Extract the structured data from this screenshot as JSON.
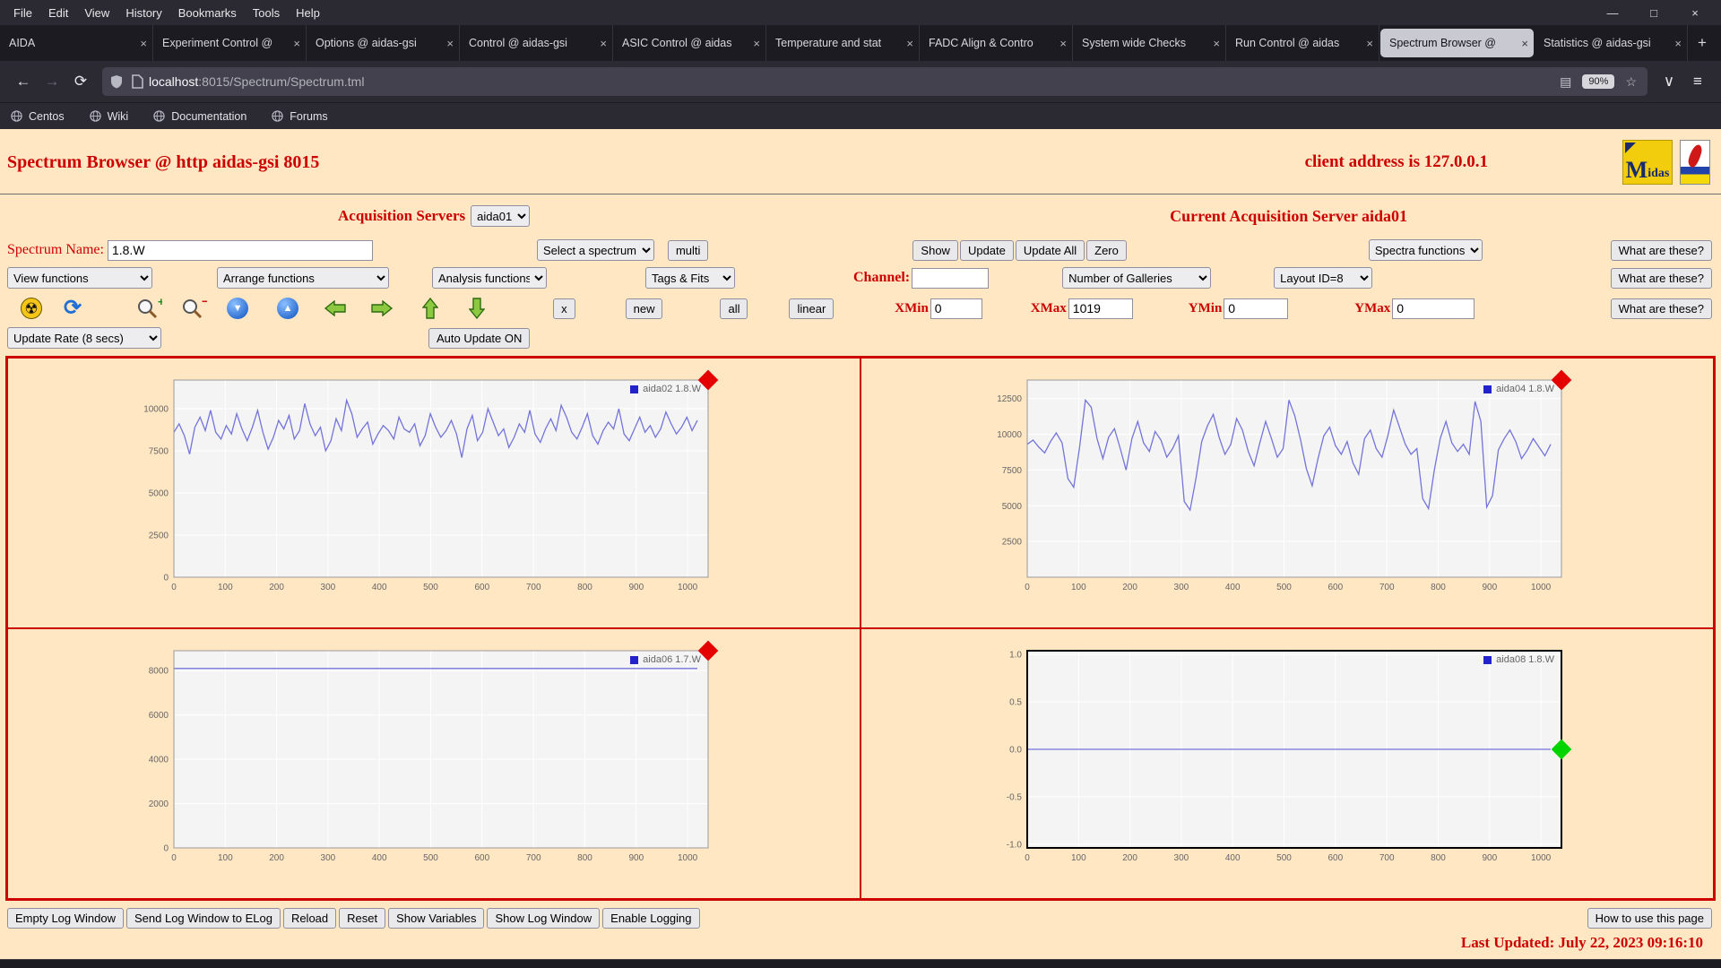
{
  "browser": {
    "menubar": {
      "items": [
        "File",
        "Edit",
        "View",
        "History",
        "Bookmarks",
        "Tools",
        "Help"
      ]
    },
    "window_controls": {
      "minimize": "—",
      "maximize": "□",
      "close": "×"
    },
    "tab_close_glyph": "×",
    "new_tab_button": "+",
    "tabs": [
      {
        "label": "AIDA",
        "active": false
      },
      {
        "label": "Experiment Control @",
        "active": false
      },
      {
        "label": "Options @ aidas-gsi",
        "active": false
      },
      {
        "label": "Control @ aidas-gsi",
        "active": false
      },
      {
        "label": "ASIC Control @ aidas",
        "active": false
      },
      {
        "label": "Temperature and stat",
        "active": false
      },
      {
        "label": "FADC Align & Contro",
        "active": false
      },
      {
        "label": "System wide Checks",
        "active": false
      },
      {
        "label": "Run Control @ aidas",
        "active": false
      },
      {
        "label": "Spectrum Browser @",
        "active": true
      },
      {
        "label": "Statistics @ aidas-gsi",
        "active": false
      }
    ],
    "navbar": {
      "back_glyph": "←",
      "forward_glyph": "→",
      "reload_glyph": "⟳",
      "reader_glyph": "▤",
      "star_glyph": "☆",
      "pocket_glyph": "∨",
      "menu_glyph": "≡",
      "url_host": "localhost",
      "url_rest": ":8015/Spectrum/Spectrum.tml",
      "zoom_badge": "90%"
    },
    "bookmarks": [
      "Centos",
      "Wiki",
      "Documentation",
      "Forums"
    ]
  },
  "page": {
    "title": "Spectrum Browser @ http aidas-gsi 8015",
    "client_address": "client address is 127.0.0.1",
    "midas_logo_text_m": "M",
    "midas_logo_text_rest": "idas",
    "acquisition": {
      "label": "Acquisition Servers",
      "selected": "aida01",
      "current": "Current Acquisition Server aida01"
    },
    "what_are_these": "What are these?",
    "spectrum_row": {
      "name_label": "Spectrum Name:",
      "name_value": "1.8.W",
      "select_spectrum": "Select a spectrum",
      "multi": "multi",
      "show": "Show",
      "update": "Update",
      "update_all": "Update All",
      "zero": "Zero",
      "spectra_functions": "Spectra functions"
    },
    "functions_row": {
      "view": "View functions",
      "arrange": "Arrange functions",
      "analysis": "Analysis functions",
      "tags": "Tags & Fits",
      "channel_label": "Channel:",
      "channel_value": "",
      "galleries": "Number of Galleries",
      "layout": "Layout ID=8"
    },
    "toolbar_row": {
      "icon_names": [
        "radiation-icon",
        "refresh-icon",
        "zoom-in-icon",
        "zoom-out-icon",
        "compress-y-icon",
        "expand-y-icon",
        "move-left-icon",
        "move-right-icon",
        "move-up-icon",
        "move-down-icon"
      ],
      "x": "x",
      "new": "new",
      "all": "all",
      "linear": "linear",
      "xmin_label": "XMin",
      "xmin_value": "0",
      "xmax_label": "XMax",
      "xmax_value": "1019",
      "ymin_label": "YMin",
      "ymin_value": "0",
      "ymax_label": "YMax",
      "ymax_value": "0"
    },
    "update_row": {
      "rate": "Update Rate (8 secs)",
      "auto": "Auto Update ON"
    },
    "log_row": {
      "buttons": [
        "Empty Log Window",
        "Send Log Window to ELog",
        "Reload",
        "Reset",
        "Show Variables",
        "Show Log Window",
        "Enable Logging"
      ],
      "help": "How to use this page"
    },
    "last_updated": "Last Updated: July 22, 2023 09:16:10"
  },
  "chart_data": {
    "type": "line",
    "plot_bg": "#f4f4f4",
    "grid_color": "#ffffff",
    "line_color": "#7474da",
    "x_axis": {
      "tick_values": [
        0,
        100,
        200,
        300,
        400,
        500,
        600,
        700,
        800,
        900,
        1000
      ],
      "tick_labels": [
        "0",
        "100",
        "200",
        "300",
        "400",
        "500",
        "600",
        "700",
        "800",
        "900",
        "1000"
      ],
      "max": 1040,
      "span": 1019
    },
    "charts": [
      {
        "legend": "aida02 1.8.W",
        "ylim": [
          0,
          11700
        ],
        "ytick_values": [
          0,
          2500,
          5000,
          7500,
          10000
        ],
        "ytick_labels": [
          "0",
          "2500",
          "5000",
          "7500",
          "10000"
        ],
        "border_color": "#999999",
        "border_width": 1,
        "marker": {
          "name": "red-diamond-marker",
          "color": "#e40000",
          "pos": "top-right"
        },
        "values": [
          8600,
          9100,
          8400,
          7300,
          8900,
          9500,
          8700,
          9900,
          8600,
          8200,
          9000,
          8500,
          9700,
          8800,
          8100,
          8900,
          9900,
          8600,
          7600,
          8300,
          9300,
          8800,
          9600,
          8200,
          8700,
          10300,
          9100,
          8400,
          8900,
          7500,
          8100,
          9400,
          8700,
          10500,
          9700,
          8300,
          8800,
          9200,
          7900,
          8500,
          9000,
          8700,
          8200,
          9500,
          8800,
          8600,
          9100,
          7800,
          8400,
          9700,
          8900,
          8300,
          8700,
          9300,
          8500,
          7100,
          8800,
          9600,
          8100,
          8600,
          10000,
          9200,
          8400,
          8800,
          7700,
          8300,
          9100,
          8600,
          9900,
          8500,
          8000,
          8800,
          9400,
          8700,
          10200,
          9500,
          8600,
          8200,
          8900,
          9700,
          8400,
          7900,
          8700,
          9200,
          8800,
          10000,
          8500,
          8100,
          8800,
          9500,
          8600,
          9000,
          8300,
          8800,
          9800,
          9100,
          8500,
          8900,
          9500,
          8700,
          9300
        ]
      },
      {
        "legend": "aida04 1.8.W",
        "ylim": [
          0,
          13800
        ],
        "ytick_values": [
          2500,
          5000,
          7500,
          10000,
          12500
        ],
        "ytick_labels": [
          "2500",
          "5000",
          "7500",
          "10000",
          "12500"
        ],
        "border_color": "#999999",
        "border_width": 1,
        "marker": {
          "name": "red-diamond-marker",
          "color": "#e40000",
          "pos": "top-right"
        },
        "values": [
          9300,
          9600,
          9100,
          8700,
          9500,
          10100,
          9400,
          6900,
          6300,
          9100,
          12400,
          11900,
          9700,
          8300,
          9800,
          10400,
          9000,
          7500,
          9700,
          10900,
          9400,
          8800,
          10200,
          9600,
          8400,
          9000,
          9900,
          5300,
          4700,
          6900,
          9500,
          10600,
          11400,
          9800,
          8600,
          9300,
          11100,
          10300,
          8800,
          7800,
          9400,
          10900,
          9700,
          8400,
          9000,
          12400,
          11300,
          9600,
          7600,
          6400,
          8300,
          9900,
          10500,
          9200,
          8600,
          9500,
          8000,
          7200,
          9700,
          10300,
          9000,
          8400,
          9900,
          11700,
          10500,
          9300,
          8600,
          9000,
          5500,
          4800,
          7500,
          9700,
          10900,
          9400,
          8800,
          9300,
          8600,
          12300,
          10900,
          4900,
          5700,
          8900,
          9700,
          10300,
          9500,
          8300,
          8900,
          9700,
          9100,
          8500,
          9300
        ]
      },
      {
        "legend": "aida06 1.7.W",
        "ylim": [
          0,
          8900
        ],
        "ytick_values": [
          0,
          2000,
          4000,
          6000,
          8000
        ],
        "ytick_labels": [
          "0",
          "2000",
          "4000",
          "6000",
          "8000"
        ],
        "border_color": "#999999",
        "border_width": 1,
        "marker": {
          "name": "red-diamond-marker",
          "color": "#e40000",
          "pos": "top-right"
        },
        "values": [
          8100,
          8100
        ]
      },
      {
        "legend": "aida08 1.8.W",
        "ylim": [
          -1.04,
          1.04
        ],
        "ytick_values": [
          -1,
          -0.5,
          0,
          0.5,
          1
        ],
        "ytick_labels": [
          "-1.0",
          "-0.5",
          "0.0",
          "0.5",
          "1.0"
        ],
        "border_color": "#000000",
        "border_width": 2,
        "marker": {
          "name": "green-diamond-marker",
          "color": "#00d400",
          "pos": "right-middle"
        },
        "values": [
          0,
          0
        ]
      }
    ]
  }
}
